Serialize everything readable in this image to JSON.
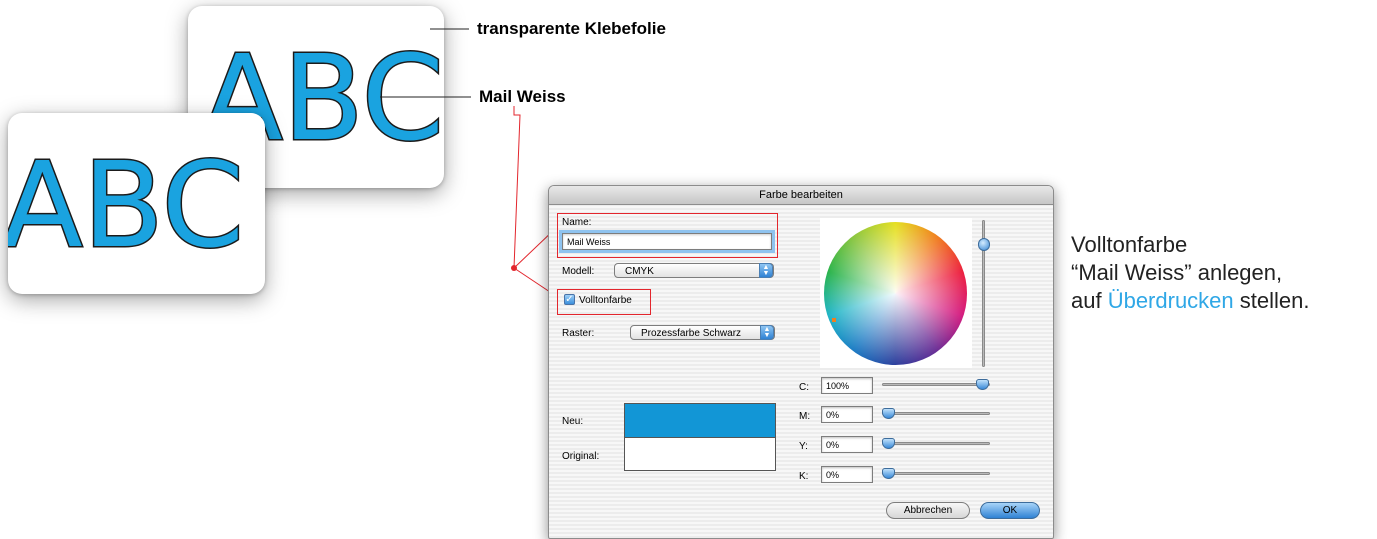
{
  "colors": {
    "accent": "#2fa7e6",
    "letter_fill": "#1aa3e0",
    "swatch_new": "#1296d6",
    "callout_line": "#e3262d"
  },
  "artwork": {
    "letters_back": "ABC",
    "letters_front": "ABC",
    "callout_top": "transparente Klebefolie",
    "callout_mid": "Mail Weiss"
  },
  "dialog": {
    "title": "Farbe bearbeiten",
    "name_label": "Name:",
    "name_value": "Mail Weiss",
    "model_label": "Modell:",
    "model_value": "CMYK",
    "spot_label": "Volltonfarbe",
    "spot_checked": true,
    "screen_label": "Raster:",
    "screen_value": "Prozessfarbe Schwarz",
    "new_label": "Neu:",
    "original_label": "Original:",
    "channels": [
      {
        "label": "C:",
        "value": "100%",
        "level": 1.0
      },
      {
        "label": "M:",
        "value": "0%",
        "level": 0.0
      },
      {
        "label": "Y:",
        "value": "0%",
        "level": 0.0
      },
      {
        "label": "K:",
        "value": "0%",
        "level": 0.0
      }
    ],
    "brightness_level": 1.0,
    "cancel_label": "Abbrechen",
    "ok_label": "OK"
  },
  "side_note": {
    "line1": "Volltonfarbe",
    "line2": "“Mail Weiss” anlegen,",
    "line3_prefix": "auf ",
    "line3_accent": "Überdrucken",
    "line3_suffix": " stellen."
  }
}
